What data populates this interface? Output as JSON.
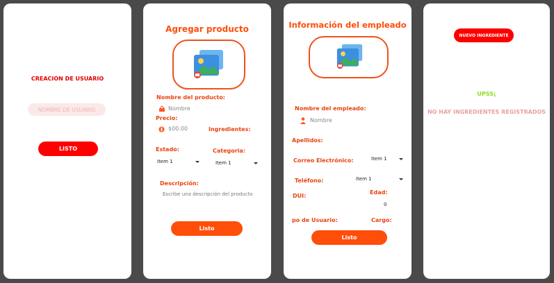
{
  "screen1": {
    "title": "CREACION DE USUARIO",
    "username_placeholder": "NOMBRE DE USUARIO",
    "done_button": "LISTO"
  },
  "screen2": {
    "title": "Agregar producto",
    "product_name_label": "Nombre del producto:",
    "product_name_placeholder": "Nombre",
    "price_label": "Precio:",
    "price_placeholder": "$00.00",
    "ingredients_label": "Ingredientes:",
    "status_label": "Estado:",
    "status_value": "Item 1",
    "category_label": "Categoria:",
    "category_value": "Item 1",
    "description_label": "Descripción:",
    "description_placeholder": "Escribe una descripción del producto",
    "done_button": "Listo"
  },
  "screen3": {
    "title": "Información del empleado",
    "employee_name_label": "Nombre del empleado:",
    "employee_name_placeholder": "Nombre",
    "surname_label": "Apellidos:",
    "email_label": "Correo Electrónico:",
    "email_select_value": "Item 1",
    "phone_label": "Teléfono:",
    "phone_select_value": "Item 1",
    "dui_label": "DUI:",
    "age_label": "Edad:",
    "age_value": "0",
    "user_type_label": "po de Usuario:",
    "position_label": "Cargo:",
    "done_button": "Listo"
  },
  "screen4": {
    "new_ingredient_button": "NUEVO INGREDIENTE",
    "oops_text": "UPSS¡",
    "empty_text": "NO HAY INGREDIENTES REGISTRADOS"
  },
  "colors": {
    "red": "#ff0000",
    "orange": "#ff4d0a",
    "oops_green": "#8fdc1a",
    "empty_pink": "#e8a0a0"
  }
}
